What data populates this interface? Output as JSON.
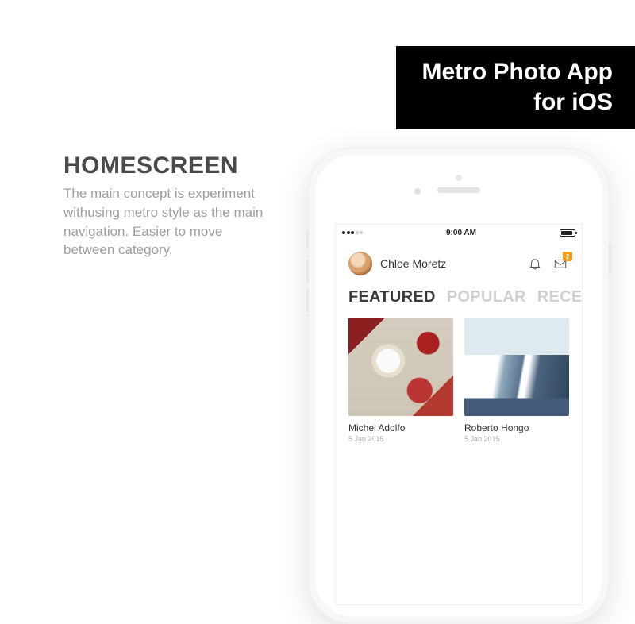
{
  "banner": {
    "line1": "Metro Photo App",
    "line2": "for iOS"
  },
  "section": {
    "title": "HOMESCREEN",
    "description": "The main concept is experiment withusing metro style as the main navigation. Easier to move between category."
  },
  "statusbar": {
    "time": "9:00 AM"
  },
  "header": {
    "username": "Chloe Moretz",
    "inbox_badge": "2"
  },
  "tabs": [
    {
      "label": "FEATURED",
      "active": true
    },
    {
      "label": "POPULAR",
      "active": false
    },
    {
      "label": "RECENT",
      "active": false
    }
  ],
  "cards": [
    {
      "title": "Michel Adolfo",
      "date": "5 Jan 2015"
    },
    {
      "title": "Roberto Hongo",
      "date": "5 Jan 2015"
    }
  ]
}
